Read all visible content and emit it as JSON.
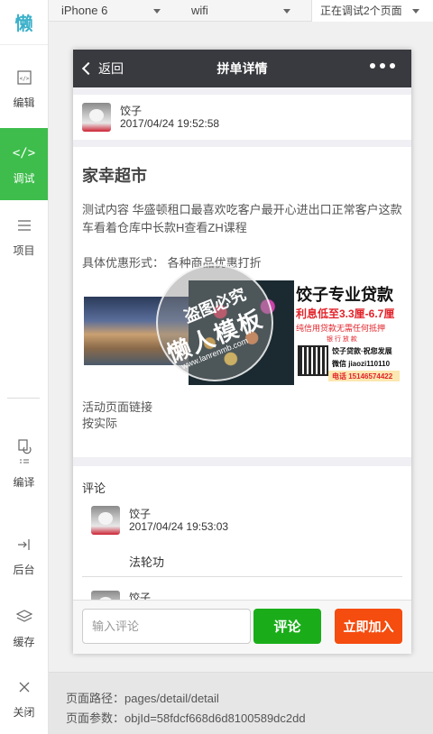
{
  "logo": {
    "glyph": "懒"
  },
  "sidebar": {
    "items": [
      {
        "label": "编辑",
        "icon": "code-file-icon"
      },
      {
        "label": "调试",
        "icon": "code-icon",
        "active": true
      },
      {
        "label": "项目",
        "icon": "menu-icon"
      },
      {
        "label": "编译",
        "icon": "compile-icon"
      },
      {
        "label": "后台",
        "icon": "backend-icon"
      },
      {
        "label": "缓存",
        "icon": "layers-icon"
      },
      {
        "label": "关闭",
        "icon": "close-icon"
      }
    ]
  },
  "topbar": {
    "device": "iPhone 6",
    "network": "wifi",
    "debug_pages": "正在调试2个页面"
  },
  "phone": {
    "nav": {
      "back_label": "返回",
      "title": "拼单详情"
    },
    "post": {
      "user": "饺子",
      "time": "2017/04/24 19:52:58"
    },
    "shop": {
      "title": "家幸超市",
      "content": "测试内容 华盛顿租口最喜欢吃客户最开心进出口正常客户这款车看着仓库中长款H查看ZH课程",
      "promo_label": "具体优惠形式：",
      "promo_value": "各种商品优惠打折",
      "link_line1": "活动页面链接",
      "link_line2": "按实际"
    },
    "ad": {
      "title": "饺子专业贷款",
      "rate": "利息低至3.3厘-6.7厘",
      "sub": "纯信用贷款无需任何抵押",
      "sub2": "银 行 放 款",
      "line1": "饺子贷款·祝您发展",
      "line2": "微信 jiaozi110110",
      "line3": "电话 15146574422"
    },
    "watermark": {
      "top": "盗图必究",
      "mid": "懒人模板",
      "bottom": "www.lanrenmb.com"
    },
    "comments": {
      "title": "评论",
      "items": [
        {
          "user": "饺子",
          "time": "2017/04/24 19:53:03",
          "text": "法轮功"
        },
        {
          "user": "饺子"
        }
      ]
    },
    "bottom": {
      "input_placeholder": "输入评论",
      "comment_button": "评论",
      "join_button": "立即加入"
    }
  },
  "footer": {
    "path_label": "页面路径：pages/detail/detail",
    "params_label": "页面参数：objId=58fdcf668d6d8100589dc2dd"
  },
  "colors": {
    "active_green": "#3ebd4c",
    "nav_dark": "#393a3f",
    "comment_green": "#1aad19",
    "join_orange": "#f54c0f"
  }
}
